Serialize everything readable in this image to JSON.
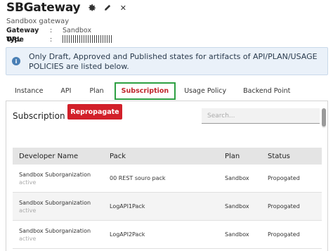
{
  "header": {
    "title": "SBGateway",
    "subtitle": "Sandbox gateway",
    "gateway_type_label": "Gateway Type",
    "gateway_type_value": "Sandbox",
    "url_label": "URL",
    "colon": ":"
  },
  "alert": {
    "icon": "i",
    "text": "Only Draft, Approved and Published states for artifacts of API/PLAN/USAGE POLICIES are listed below."
  },
  "tabs": [
    {
      "label": "Instance"
    },
    {
      "label": "API"
    },
    {
      "label": "Plan"
    },
    {
      "label": "Subscription",
      "active": true
    },
    {
      "label": "Usage Policy"
    },
    {
      "label": "Backend Point"
    }
  ],
  "panel": {
    "title": "Subscription",
    "repropagate_label": "Repropagate",
    "search_placeholder": "Search..."
  },
  "table": {
    "headers": [
      "Developer Name",
      "Pack",
      "Plan",
      "Status"
    ],
    "rows": [
      {
        "developer": "Sandbox Suborganization",
        "dev_status": "active",
        "pack": "00 REST souro pack",
        "plan": "Sandbox",
        "status": "Propogated"
      },
      {
        "developer": "Sandbox Suborganization",
        "dev_status": "active",
        "pack": "LogAPI1Pack",
        "plan": "Sandbox",
        "status": "Propogated"
      },
      {
        "developer": "Sandbox Suborganization",
        "dev_status": "active",
        "pack": "LogAPI2Pack",
        "plan": "Sandbox",
        "status": "Propogated"
      }
    ]
  },
  "colors": {
    "accent_red": "#d2202a",
    "active_tab_text": "#c0262d",
    "highlight_border": "#2ea043",
    "info_blue": "#4a7fb5"
  },
  "icons": [
    "gear-icon",
    "pencil-icon",
    "close-icon",
    "info-icon"
  ]
}
